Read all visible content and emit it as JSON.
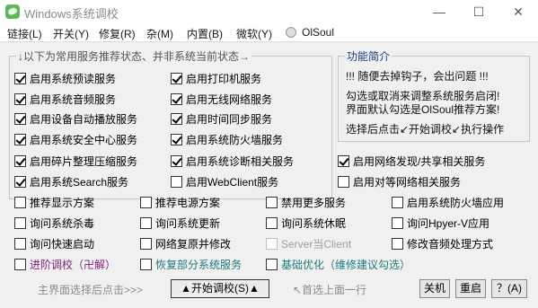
{
  "window": {
    "title": "Windows系统调校",
    "min_glyph": "—",
    "max_glyph": "☐",
    "close_glyph": "✕"
  },
  "menu": [
    "链接(L)",
    "开关(Y)",
    "修复(R)",
    "杂(M)",
    "内置(B)",
    "微软(Y)",
    "OlSoul"
  ],
  "group": {
    "legend": "↓以下为常用服务推荐状态、并非系统当前状态→"
  },
  "info": {
    "title": "功能简介",
    "lines": [
      "!!! 随便去掉钩子，会出问题 !!!",
      "勾选或取消来调整系统服务启闭!",
      "界面默认勾选是OlSoul推荐方案!",
      "选择后点击↙开始调校↙执行操作"
    ]
  },
  "services": [
    {
      "label": "启用系统预读服务",
      "checked": true
    },
    {
      "label": "启用打印机服务",
      "checked": true
    },
    {
      "label": "启用系统音频服务",
      "checked": true
    },
    {
      "label": "启用无线网络服务",
      "checked": true
    },
    {
      "label": "启用设备自动播放服务",
      "checked": true
    },
    {
      "label": "启用时间同步服务",
      "checked": true
    },
    {
      "label": "启用系统安全中心服务",
      "checked": true
    },
    {
      "label": "启用系统防火墙服务",
      "checked": true
    },
    {
      "label": "启用碎片整理压缩服务",
      "checked": true
    },
    {
      "label": "启用系统诊断相关服务",
      "checked": true
    },
    {
      "label": "启用网络发现/共享相关服务",
      "checked": true
    },
    {
      "label": "启用系统Search服务",
      "checked": true
    },
    {
      "label": "启用WebClient服务",
      "checked": false
    },
    {
      "label": "启用对等网络相关服务",
      "checked": false
    }
  ],
  "options": [
    {
      "label": "推荐显示方案",
      "checked": false
    },
    {
      "label": "推荐电源方案",
      "checked": false
    },
    {
      "label": "禁用更多服务",
      "checked": false
    },
    {
      "label": "启用系统防火墙应用",
      "checked": false
    },
    {
      "label": "询问系统杀毒",
      "checked": false
    },
    {
      "label": "询问系统更新",
      "checked": false
    },
    {
      "label": "询问系统休眠",
      "checked": false
    },
    {
      "label": "询问Hpyer-V应用",
      "checked": false
    },
    {
      "label": "询问快速启动",
      "checked": false
    },
    {
      "label": "网络复原并修改",
      "checked": false
    },
    {
      "label": "Server当Client",
      "checked": false,
      "disabled": true
    },
    {
      "label": "修改音频处理方式",
      "checked": false
    }
  ],
  "extras": [
    {
      "label": "进阶调校（卍解）",
      "checked": false
    },
    {
      "label": "恢复部分系统服务",
      "checked": false
    },
    {
      "label": "基础优化（维修建议勾选）",
      "checked": false
    }
  ],
  "bottom": {
    "hint_left": "主界面选择后点击>>>",
    "start_button": "▲开始调校(S)▲",
    "hint_right": "↖首选上面一行",
    "shutdown_button": "关机",
    "restart_button": "重启",
    "help_button": "？(A)"
  },
  "colors": {
    "title_gray": "#8a8a8a",
    "extra_purple": "#7a1f7a",
    "extra_teal": "#1d7a7a",
    "info_title_blue": "#1b3a8a"
  }
}
